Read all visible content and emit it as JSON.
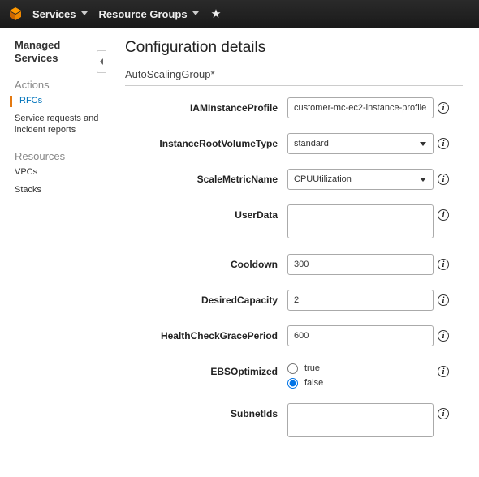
{
  "topbar": {
    "services": "Services",
    "resource_groups": "Resource Groups"
  },
  "sidebar": {
    "title_l1": "Managed",
    "title_l2": "Services",
    "actions_hdr": "Actions",
    "rfcs": "RFCs",
    "srir": "Service requests and incident reports",
    "resources_hdr": "Resources",
    "vpcs": "VPCs",
    "stacks": "Stacks"
  },
  "main": {
    "title": "Configuration details",
    "section": "AutoScalingGroup*"
  },
  "form": {
    "iam_instance_profile": {
      "label": "IAMInstanceProfile",
      "value": "customer-mc-ec2-instance-profile"
    },
    "instance_root_volume_type": {
      "label": "InstanceRootVolumeType",
      "value": "standard"
    },
    "scale_metric_name": {
      "label": "ScaleMetricName",
      "value": "CPUUtilization"
    },
    "user_data": {
      "label": "UserData",
      "value": ""
    },
    "cooldown": {
      "label": "Cooldown",
      "value": "300"
    },
    "desired_capacity": {
      "label": "DesiredCapacity",
      "value": "2"
    },
    "health_check_grace_period": {
      "label": "HealthCheckGracePeriod",
      "value": "600"
    },
    "ebs_optimized": {
      "label": "EBSOptimized",
      "true_label": "true",
      "false_label": "false",
      "value": "false"
    },
    "subnet_ids": {
      "label": "SubnetIds",
      "value": ""
    }
  }
}
